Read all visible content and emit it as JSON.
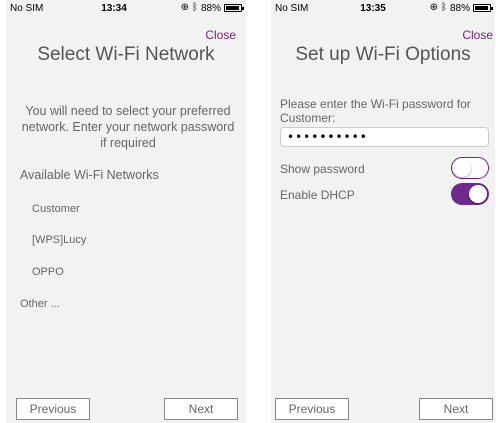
{
  "left_screen": {
    "status": {
      "carrier": "No SIM",
      "time": "13:34",
      "battery": "88%"
    },
    "close_label": "Close",
    "title": "Select Wi-Fi Network",
    "description": "You will need to select your preferred network. Enter your network password if required",
    "networks_label": "Available Wi-Fi Networks",
    "networks": [
      "Customer",
      "[WPS]Lucy",
      "OPPO"
    ],
    "other_label": "Other ...",
    "previous_label": "Previous",
    "next_label": "Next"
  },
  "right_screen": {
    "status": {
      "carrier": "No SIM",
      "time": "13:35",
      "battery": "88%"
    },
    "close_label": "Close",
    "title": "Set up Wi-Fi Options",
    "password_prompt": "Please enter the Wi-Fi password for Customer:",
    "password_value": "••••••••••",
    "show_password_label": "Show password",
    "show_password_on": false,
    "dhcp_label": "Enable DHCP",
    "dhcp_on": true,
    "previous_label": "Previous",
    "next_label": "Next"
  },
  "colors": {
    "accent": "#7a1f8b",
    "toggle_on": "#6d2a8a",
    "screen_bg": "#f2f2f2"
  }
}
